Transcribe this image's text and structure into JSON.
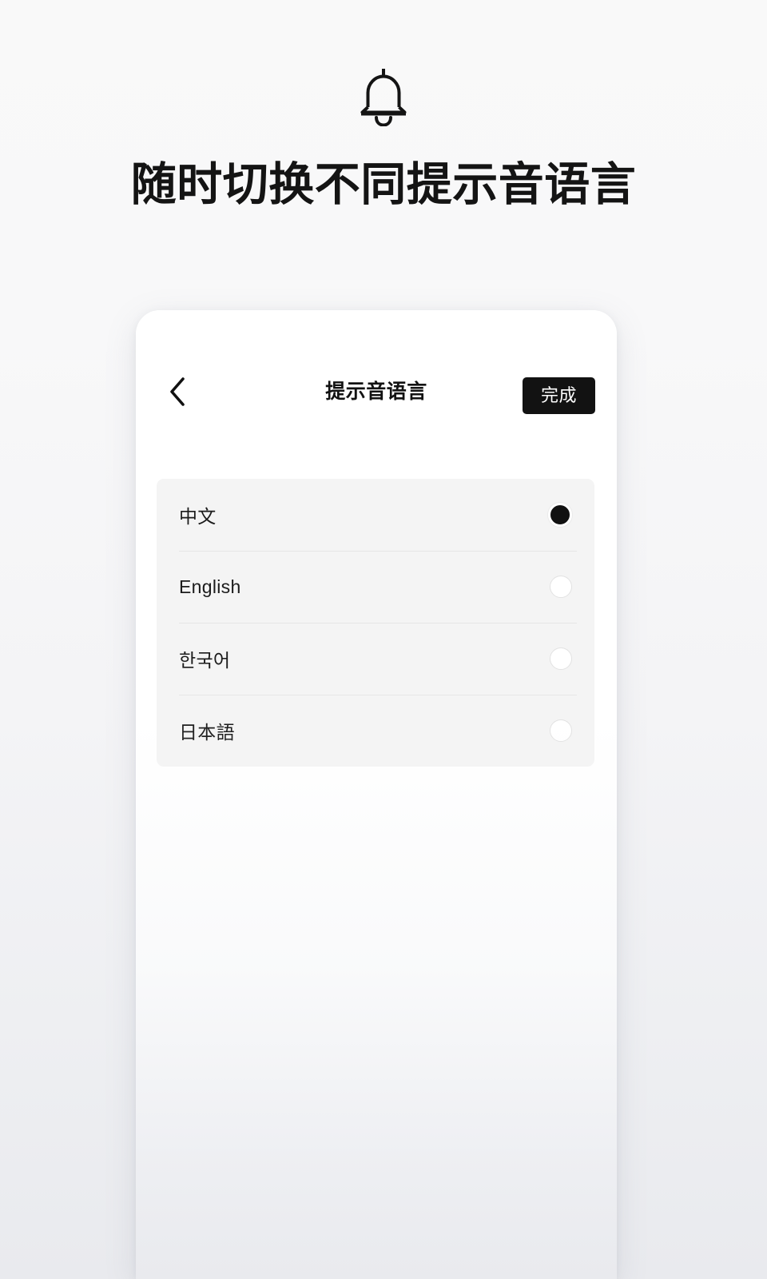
{
  "hero": {
    "icon": "bell-icon",
    "headline": "随时切换不同提示音语言"
  },
  "phone": {
    "nav": {
      "back_icon": "chevron-left-icon",
      "title": "提示音语言",
      "done_label": "完成"
    },
    "options": [
      {
        "label": "中文",
        "selected": true
      },
      {
        "label": "English",
        "selected": false
      },
      {
        "label": "한국어",
        "selected": false
      },
      {
        "label": "日本語",
        "selected": false
      }
    ]
  },
  "colors": {
    "accent": "#121212",
    "page_bg_top": "#f9f9f9",
    "page_bg_bottom": "#e9eaee",
    "card_bg": "#ffffff",
    "list_bg": "#f4f4f4",
    "divider": "#e6e6e6",
    "radio_selected": "#111111",
    "radio_unselected": "#ffffff"
  }
}
